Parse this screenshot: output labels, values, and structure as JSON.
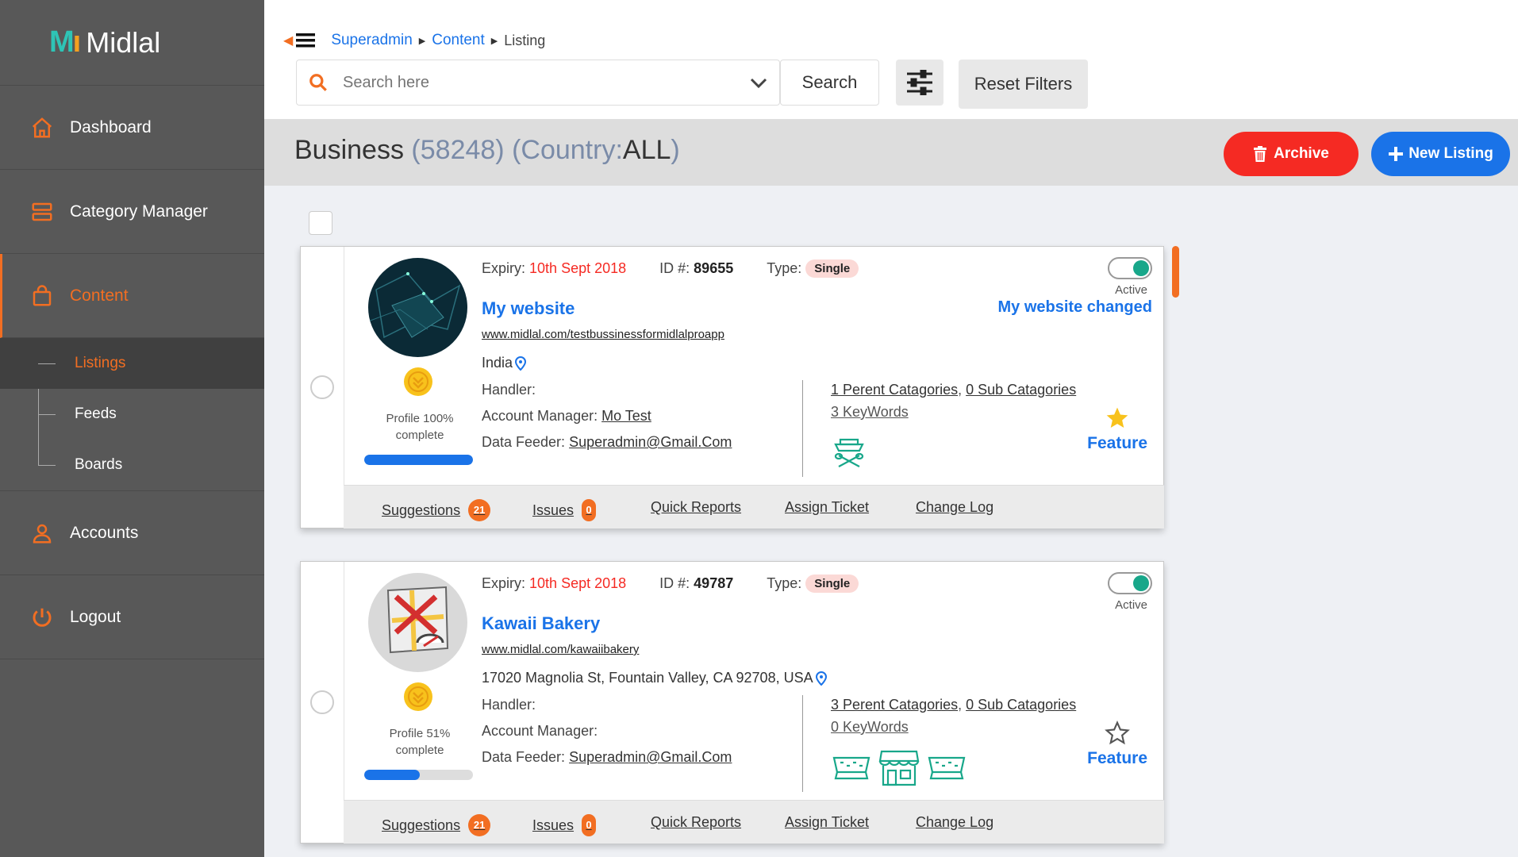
{
  "app": {
    "logo_text": "Midlal"
  },
  "sidebar": {
    "items": [
      {
        "label": "Dashboard"
      },
      {
        "label": "Category Manager"
      },
      {
        "label": "Content"
      },
      {
        "label": "Accounts"
      },
      {
        "label": "Logout"
      }
    ],
    "subitems": [
      {
        "label": "Listings"
      },
      {
        "label": "Feeds"
      },
      {
        "label": "Boards"
      }
    ]
  },
  "breadcrumb": {
    "items": [
      "Superadmin",
      "Content"
    ],
    "current": "Listing"
  },
  "search": {
    "placeholder": "Search here",
    "value": "",
    "button_label": "Search",
    "reset_label": "Reset Filters"
  },
  "header": {
    "title": "Business",
    "count": "(58248)",
    "country_prefix": "(Country:",
    "country_value": "ALL",
    "country_suffix": ")",
    "archive_label": "Archive",
    "new_label": "New Listing"
  },
  "listings": [
    {
      "expiry_label": "Expiry:",
      "expiry_value": "10th Sept 2018",
      "id_label": "ID #:",
      "id_value": "89655",
      "type_label": "Type:",
      "type_value": "Single",
      "status": "Active",
      "name": "My website",
      "changed_name": "My website changed",
      "url": "www.midlal.com/testbussinessformidlalproapp",
      "location": "India",
      "handler_label": "Handler:",
      "handler_value": "",
      "manager_label": "Account Manager:",
      "manager_value": "Mo Test",
      "feeder_label": "Data Feeder:",
      "feeder_value": "Superadmin@Gmail.Com",
      "profile_line1": "Profile 100%",
      "profile_line2": "complete",
      "profile_percent": 100,
      "parent_cats": "1 Perent Catagories",
      "sub_cats": "0 Sub Catagories",
      "keywords": "3 KeyWords",
      "featured": true,
      "feature_label": "Feature",
      "footer": {
        "suggestions": "Suggestions",
        "suggestions_count": "21",
        "issues": "Issues",
        "issues_count": "0",
        "quick_reports": "Quick Reports",
        "assign_ticket": "Assign Ticket",
        "change_log": "Change Log"
      }
    },
    {
      "expiry_label": "Expiry:",
      "expiry_value": "10th Sept 2018",
      "id_label": "ID #:",
      "id_value": "49787",
      "type_label": "Type:",
      "type_value": "Single",
      "status": "Active",
      "name": "Kawaii Bakery",
      "changed_name": "",
      "url": "www.midlal.com/kawaiibakery",
      "location": "17020 Magnolia St, Fountain Valley, CA 92708, USA",
      "handler_label": "Handler:",
      "handler_value": "",
      "manager_label": "Account Manager:",
      "manager_value": "",
      "feeder_label": "Data Feeder:",
      "feeder_value": "Superadmin@Gmail.Com",
      "profile_line1": "Profile 51%",
      "profile_line2": "complete",
      "profile_percent": 51,
      "parent_cats": "3 Perent Catagories",
      "sub_cats": "0 Sub Catagories",
      "keywords": "0 KeyWords",
      "featured": false,
      "feature_label": "Feature",
      "footer": {
        "suggestions": "Suggestions",
        "suggestions_count": "21",
        "issues": "Issues",
        "issues_count": "0",
        "quick_reports": "Quick Reports",
        "assign_ticket": "Assign Ticket",
        "change_log": "Change Log"
      }
    }
  ],
  "colors": {
    "accent": "#f26e22",
    "primary": "#1a73e8",
    "danger": "#f52a23",
    "sidebar": "#585858",
    "toggle_on": "#18a78a"
  }
}
